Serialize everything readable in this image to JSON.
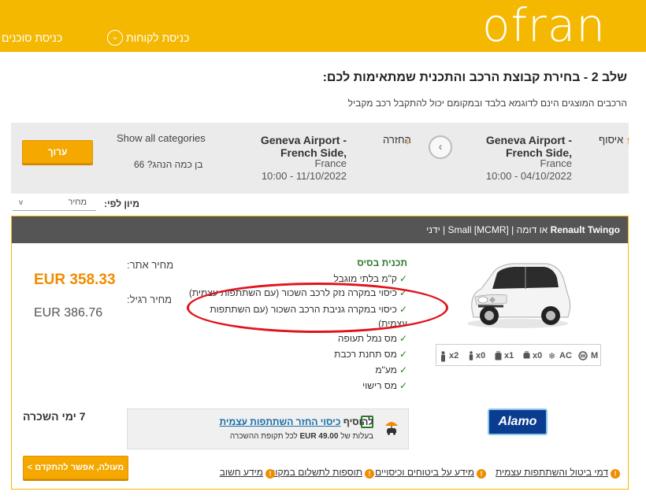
{
  "header": {
    "logo": "ofran",
    "agents_login": "כניסת סוכנים",
    "customers_login": "כניסת לקוחות",
    "chevron": "⌄"
  },
  "page": {
    "title": "שלב 2 - בחירת קבוצת הרכב והתכנית שמתאימות לכם:",
    "subtitle": "הרכבים המוצגים הינם לדוגמא בלבד ובמקומם יכול להתקבל רכב מקביל"
  },
  "summary": {
    "pickup_label": "איסוף",
    "pickup_location_line1": "Geneva Airport -",
    "pickup_location_line2": "French Side,",
    "pickup_country": "France",
    "pickup_datetime": "10:00 - 04/10/2022",
    "return_label": "החזרה",
    "return_location_line1": "Geneva Airport -",
    "return_location_line2": "French Side,",
    "return_country": "France",
    "return_datetime": "10:00 - 11/10/2022",
    "show_all": "Show all categories",
    "driver_age": "בן כמה הנהג? 66",
    "edit": "ערוך",
    "back_icon": "‹",
    "arrow_up": "↑",
    "arrow_down": "↓"
  },
  "sort": {
    "label": "מיון לפי:",
    "value": "מחיר",
    "caret": "v"
  },
  "result": {
    "car_model": "Renault Twingo",
    "car_details": " או דומה | Small [MCMR] | ידני",
    "price_site_label": "מחיר אתר:",
    "price_site": "EUR  358.33",
    "price_regular_label": "מחיר רגיל:",
    "price_regular": "EUR  386.76",
    "plan_title": "תכנית בסיס",
    "features": [
      "ק\"מ בלתי מוגבל",
      "כיסוי במקרה נזק לרכב השכור (עם השתתפות עצמית)",
      "כיסוי במקרה גניבת הרכב השכור (עם השתתפות עצמית)",
      "מס נמל תעופה",
      "מס תחנת רכבת",
      "מע\"מ",
      "מס רישוי"
    ],
    "check": "✓",
    "specs": {
      "adults": "x2",
      "children": "x0",
      "large_bags": "x1",
      "small_bags": "x0",
      "ac": "AC",
      "transmission": "M"
    },
    "rental_days": "7 ימי השכרה",
    "addon_prefix": "להוסיף",
    "addon_link": "כיסוי החזר השתתפות עצמית",
    "addon_price_prefix": "בעלות של",
    "addon_price": "EUR 49.00",
    "addon_price_suffix": "לכל תקופת ההשכרה",
    "supplier": "Alamo",
    "proceed": "מעולה, אפשר להתקדם >",
    "info_links": [
      "דמי ביטול והשתתפות עצמית",
      "מידע על ביטוחים וכיסויים",
      "תוספות לתשלום במקום",
      "מידע חשוב"
    ],
    "info_icon": "!"
  },
  "colors": {
    "brand": "#f5b800",
    "accent": "#f08c00",
    "plan_green": "#2a7a2a",
    "annotation": "#e0141e"
  }
}
